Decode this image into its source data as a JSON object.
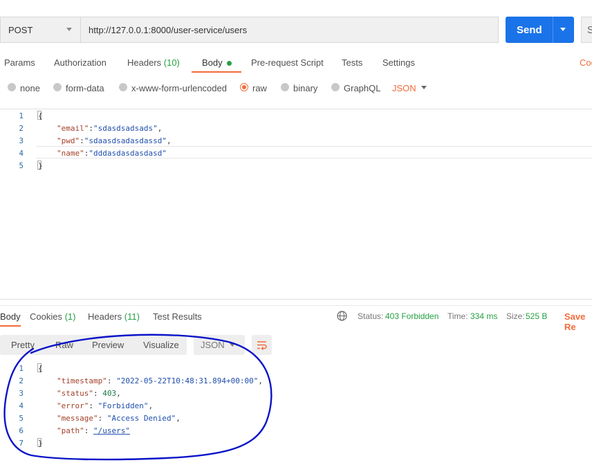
{
  "request": {
    "method": "POST",
    "url": "http://127.0.0.1:8000/user-service/users",
    "send_label": "Send",
    "save_partial": "S"
  },
  "request_tabs": [
    {
      "label": "Params"
    },
    {
      "label": "Authorization"
    },
    {
      "label": "Headers",
      "count": "(10)"
    },
    {
      "label": "Body"
    },
    {
      "label": "Pre-request Script"
    },
    {
      "label": "Tests"
    },
    {
      "label": "Settings"
    }
  ],
  "cookies_partial": "Coo",
  "body_types": [
    "none",
    "form-data",
    "x-www-form-urlencoded",
    "raw",
    "binary",
    "GraphQL"
  ],
  "body_format": "JSON",
  "request_body": {
    "line_numbers": [
      "1",
      "2",
      "3",
      "4",
      "5"
    ],
    "open": "{",
    "close": "}",
    "fields": [
      {
        "key": "\"email\"",
        "value": "\"sdasdsadsads\"",
        "sep": ","
      },
      {
        "key": "\"pwd\"",
        "value": "\"sdaasdsadasdassd\"",
        "sep": ","
      },
      {
        "key": "\"name\"",
        "value": "\"dddasdasdasdasd\"",
        "sep": ""
      }
    ]
  },
  "response_tabs": [
    {
      "label": "Body"
    },
    {
      "label": "Cookies",
      "count": "(1)"
    },
    {
      "label": "Headers",
      "count": "(11)"
    },
    {
      "label": "Test Results"
    }
  ],
  "response_meta": {
    "status_label": "Status:",
    "status_value": "403 Forbidden",
    "time_label": "Time:",
    "time_value": "334 ms",
    "size_label": "Size:",
    "size_value": "525 B",
    "save_response": "Save Re"
  },
  "view_modes": [
    "Pretty",
    "Raw",
    "Preview",
    "Visualize"
  ],
  "response_format": "JSON",
  "response_body": {
    "line_numbers": [
      "1",
      "2",
      "3",
      "4",
      "5",
      "6",
      "7"
    ],
    "open": "{",
    "close": "}",
    "fields": [
      {
        "key": "\"timestamp\"",
        "value": "\"2022-05-22T10:48:31.894+00:00\"",
        "sep": ","
      },
      {
        "key": "\"status\"",
        "value": "403",
        "sep": ","
      },
      {
        "key": "\"error\"",
        "value": "\"Forbidden\"",
        "sep": ","
      },
      {
        "key": "\"message\"",
        "value": "\"Access Denied\"",
        "sep": ","
      },
      {
        "key": "\"path\"",
        "value": "\"/users\"",
        "sep": ""
      }
    ]
  },
  "colors": {
    "accent": "#f26b3a",
    "send_button": "#1a73e8",
    "success": "#26a044",
    "annotation": "#0a14c8"
  }
}
